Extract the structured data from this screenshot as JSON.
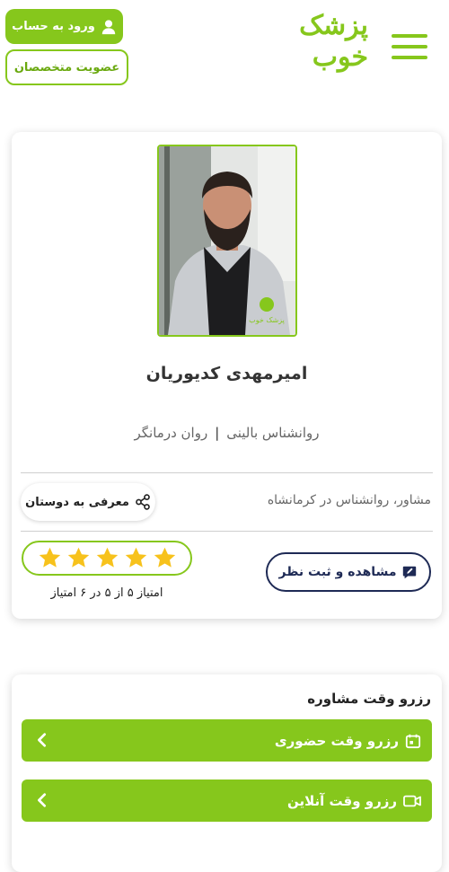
{
  "header": {
    "login_label": "ورود به حساب",
    "membership_label": "عضویت متخصصان",
    "logo_text": "پزشک خوب"
  },
  "profile": {
    "name": "امیرمهدی کدیوریان",
    "specialty_1": "روانشناس بالینی",
    "separator": "|",
    "specialty_2": "روان درمانگر",
    "description": "مشاور، روانشناس در کرمانشاه",
    "share_label": "معرفی به دوستان",
    "rating_stars": 5,
    "rating_max": 5,
    "rating_text": "امتیاز ۵ از ۵ در ۶ امتیاز",
    "review_label": "مشاهده و ثبت نظر",
    "photo_watermark": "پزشک خوب"
  },
  "booking": {
    "title": "رزرو وقت مشاوره",
    "options": [
      {
        "label": "رزرو وقت حضوری",
        "icon": "calendar-icon"
      },
      {
        "label": "رزرو وقت آنلاین",
        "icon": "video-icon"
      }
    ]
  },
  "colors": {
    "brand_green": "#86c71c",
    "star_yellow": "#f7c21c",
    "navy": "#1e2a55"
  }
}
